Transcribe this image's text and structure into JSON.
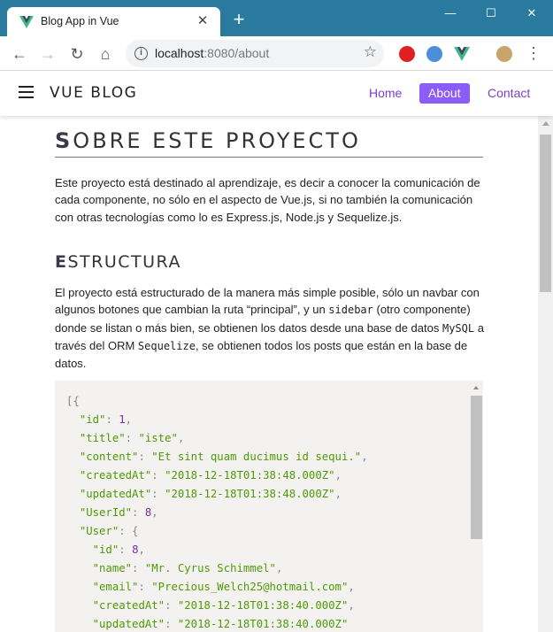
{
  "browser": {
    "tab_title": "Blog App in Vue",
    "tab_close": "✕",
    "new_tab": "+",
    "window_minimize": "—",
    "window_maximize": "☐",
    "window_close": "✕",
    "url_host": "localhost",
    "url_rest": ":8080/about",
    "accent": "#2a7aa0"
  },
  "app": {
    "brand": "VUE BLOG",
    "nav": {
      "home": "Home",
      "about": "About",
      "contact": "Contact"
    },
    "accent": "#8b5cf6"
  },
  "page": {
    "title_first": "S",
    "title_rest": "OBRE ESTE PROYECTO",
    "intro": "Este proyecto está destinado al aprendizaje, es decir a conocer la comunicación de cada componente, no sólo en el aspecto de Vue.js, si no también la comunicación con otras tecnologías como lo es Express.js, Node.js y Sequelize.js.",
    "subtitle_first": "E",
    "subtitle_rest": "STRUCTURA",
    "structure": {
      "part1": "El proyecto está estructurado de la manera más simple posible, sólo un navbar con algunos botones que cambian la ruta “principal”, y un ",
      "sidebar": "sidebar",
      "part2": " (otro componente) donde se listan o más bien, se obtienen los datos desde una base de datos ",
      "mysql": "MySQL",
      "part3": " a través del ORM ",
      "sequelize": "Sequelize",
      "part4": ", se obtienen todos los posts que están en la base de datos."
    },
    "code": {
      "open": "[{",
      "id_key": "\"id\"",
      "id_val": "1",
      "title_key": "\"title\"",
      "title_val": "\"iste\"",
      "content_key": "\"content\"",
      "content_val": "\"Et sint quam ducimus id sequi.\"",
      "created_key": "\"createdAt\"",
      "created_val": "\"2018-12-18T01:38:48.000Z\"",
      "updated_key": "\"updatedAt\"",
      "updated_val": "\"2018-12-18T01:38:48.000Z\"",
      "userid_key": "\"UserId\"",
      "userid_val": "8",
      "user_key": "\"User\"",
      "u_id_key": "\"id\"",
      "u_id_val": "8",
      "u_name_key": "\"name\"",
      "u_name_val": "\"Mr. Cyrus Schimmel\"",
      "u_email_key": "\"email\"",
      "u_email_val": "\"Precious_Welch25@hotmail.com\"",
      "u_created_key": "\"createdAt\"",
      "u_created_val": "\"2018-12-18T01:38:40.000Z\"",
      "u_updated_key": "\"updatedAt\"",
      "u_updated_val": "\"2018-12-18T01:38:40.000Z\""
    }
  }
}
